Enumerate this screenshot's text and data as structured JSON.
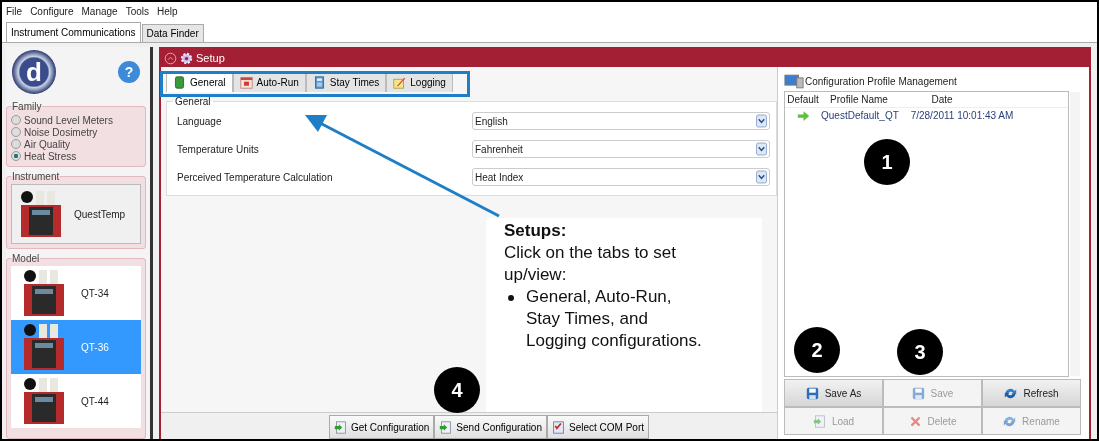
{
  "menu": [
    "File",
    "Configure",
    "Manage",
    "Tools",
    "Help"
  ],
  "app_tabs": [
    {
      "label": "Instrument Communications",
      "selected": true
    },
    {
      "label": "Data Finder",
      "selected": false
    }
  ],
  "sidebar": {
    "logo": "d",
    "help": "?",
    "family": {
      "title": "Family",
      "options": [
        {
          "label": "Sound Level Meters",
          "selected": false
        },
        {
          "label": "Noise Dosimetry",
          "selected": false
        },
        {
          "label": "Air Quality",
          "selected": false
        },
        {
          "label": "Heat Stress",
          "selected": true
        }
      ]
    },
    "instrument": {
      "title": "Instrument",
      "name": "QuestTemp"
    },
    "model": {
      "title": "Model",
      "items": [
        {
          "label": "QT-34",
          "selected": false
        },
        {
          "label": "QT-36",
          "selected": true
        },
        {
          "label": "QT-44",
          "selected": false
        }
      ]
    }
  },
  "setup": {
    "title": "Setup",
    "tabs": [
      {
        "label": "General",
        "kind": "phone",
        "selected": true
      },
      {
        "label": "Auto-Run",
        "kind": "calendar",
        "selected": false
      },
      {
        "label": "Stay Times",
        "kind": "calculator",
        "selected": false
      },
      {
        "label": "Logging",
        "kind": "notepad",
        "selected": false
      }
    ],
    "group_title": "General",
    "fields": [
      {
        "label": "Language",
        "value": "English"
      },
      {
        "label": "Temperature Units",
        "value": "Fahrenheit"
      },
      {
        "label": "Perceived Temperature Calculation",
        "value": "Heat Index"
      }
    ],
    "bottom_buttons": [
      {
        "label": "Get Configuration",
        "kind": "get"
      },
      {
        "label": "Send Configuration",
        "kind": "send"
      },
      {
        "label": "Select COM Port",
        "kind": "port"
      }
    ]
  },
  "profiles": {
    "title": "Configuration Profile Management",
    "columns": [
      "Default",
      "Profile Name",
      "Date"
    ],
    "rows": [
      {
        "default": true,
        "name": "QuestDefault_QT",
        "date": "7/28/2011 10:01:43 AM"
      }
    ],
    "buttons": [
      {
        "label": "Save As",
        "kind": "save",
        "disabled": false
      },
      {
        "label": "Save",
        "kind": "save",
        "disabled": true
      },
      {
        "label": "Refresh",
        "kind": "refresh",
        "disabled": false
      },
      {
        "label": "Load",
        "kind": "load",
        "disabled": true
      },
      {
        "label": "Delete",
        "kind": "delete",
        "disabled": true
      },
      {
        "label": "Rename",
        "kind": "rename",
        "disabled": true
      }
    ]
  },
  "annotation": {
    "title": "Setups:",
    "text": "Click on the tabs to set up/view:",
    "bullets": [
      "General, Auto-Run, Stay Times, and Logging configurations."
    ],
    "markers": [
      "1",
      "2",
      "3",
      "4"
    ]
  }
}
